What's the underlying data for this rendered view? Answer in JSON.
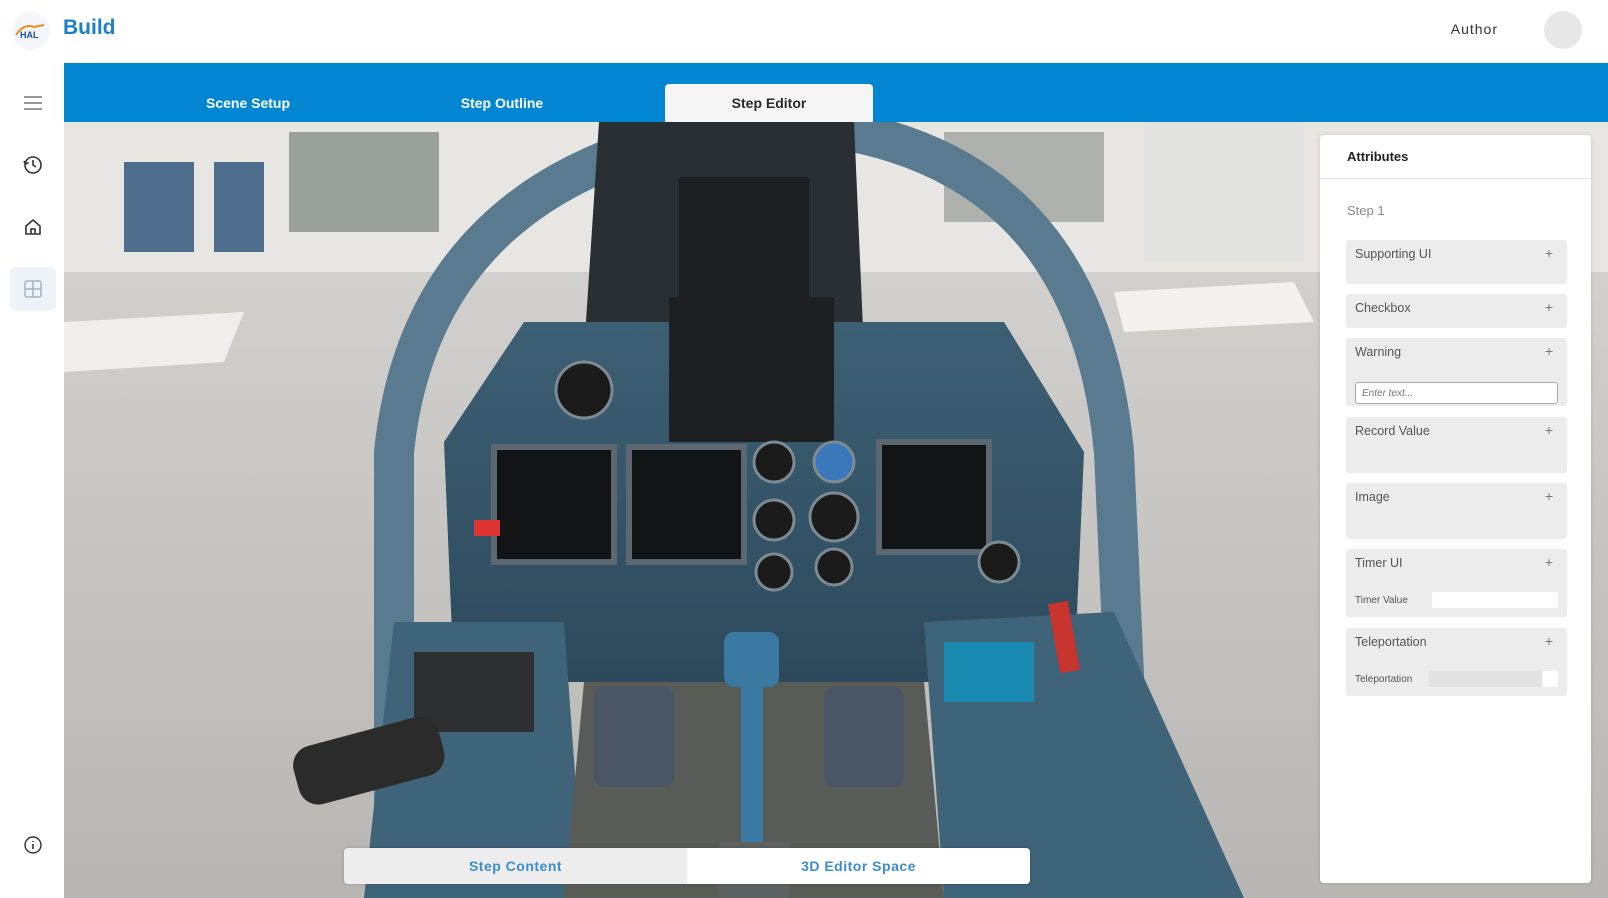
{
  "app": {
    "title": "Build",
    "author_label": "Author"
  },
  "tabs": [
    {
      "label": "Scene Setup",
      "active": false
    },
    {
      "label": "Step Outline",
      "active": false
    },
    {
      "label": "Step Editor",
      "active": true
    }
  ],
  "sidebar": {
    "items": [
      {
        "icon": "menu-icon",
        "active": false
      },
      {
        "icon": "history-icon",
        "active": false
      },
      {
        "icon": "home-icon",
        "active": false
      },
      {
        "icon": "grid-icon",
        "active": true
      }
    ],
    "bottom_icon": "info-icon"
  },
  "attributes": {
    "title": "Attributes",
    "step": "Step 1",
    "cards": {
      "supporting_ui": "Supporting UI",
      "checkbox": "Checkbox",
      "warning": "Warning",
      "warning_placeholder": "Enter text...",
      "record_value": "Record Value",
      "image": "Image",
      "timer_ui": "Timer UI",
      "timer_value_label": "Timer Value",
      "teleportation": "Teleportation",
      "teleportation_label": "Teleportation"
    },
    "plus": "+"
  },
  "bottom": {
    "step_content": "Step Content",
    "editor_space": "3D Editor Space"
  },
  "colors": {
    "accent": "#0386d1",
    "title_blue": "#1f7fc6",
    "cockpit_blue": "#4a6f86"
  }
}
